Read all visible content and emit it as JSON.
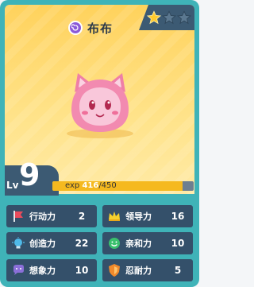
{
  "name": "布布",
  "stars": {
    "filled": 1,
    "total": 3
  },
  "level": {
    "label": "Lv",
    "value": "9"
  },
  "exp": {
    "label": "exp",
    "current": "416",
    "max": "/450",
    "progress": 0.924
  },
  "stats": [
    {
      "label": "行动力",
      "value": "2",
      "icon": "flag-icon"
    },
    {
      "label": "领导力",
      "value": "16",
      "icon": "crown-icon"
    },
    {
      "label": "创造力",
      "value": "22",
      "icon": "lightbulb-icon"
    },
    {
      "label": "亲和力",
      "value": "10",
      "icon": "smile-icon"
    },
    {
      "label": "想象力",
      "value": "10",
      "icon": "thought-icon"
    },
    {
      "label": "忍耐力",
      "value": "5",
      "icon": "shield-icon"
    }
  ],
  "colors": {
    "card": "#3fb3b8",
    "panel": "#ffd25c",
    "dark": "#3c5a73",
    "exp_fill": "#f5b91f",
    "pet_pink": "#f28ab0"
  }
}
